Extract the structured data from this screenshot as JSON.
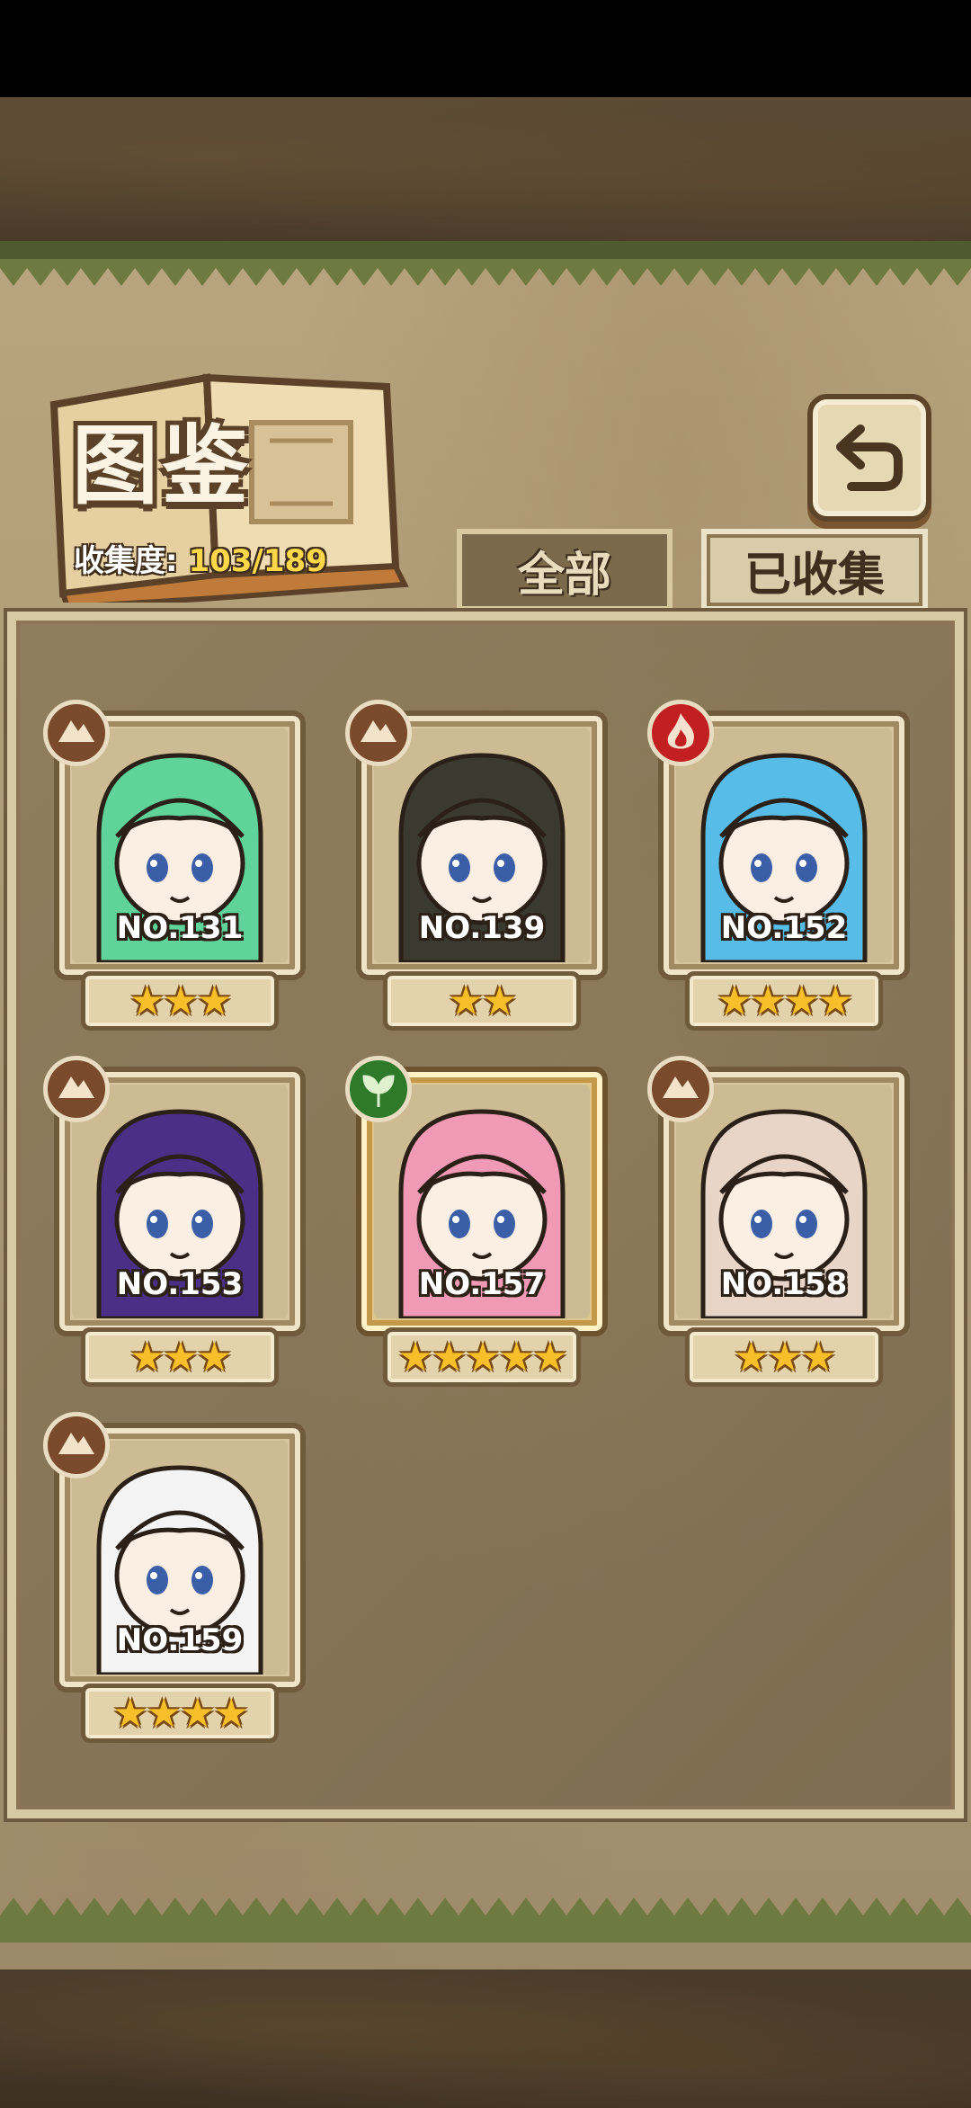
{
  "header": {
    "title": "图鉴",
    "collection_label": "收集度:",
    "collection_count": "103/189"
  },
  "tabs": [
    {
      "label": "全部",
      "selected": false
    },
    {
      "label": "已收集",
      "selected": true
    }
  ],
  "cards": [
    {
      "no": "NO.131",
      "stars": "★★★",
      "star_count": 3,
      "element": "earth-icon",
      "hair": "#5fd39a"
    },
    {
      "no": "NO.139",
      "stars": "★★",
      "star_count": 2,
      "element": "earth-icon",
      "hair": "#3b3a30"
    },
    {
      "no": "NO.152",
      "stars": "★★★★",
      "star_count": 4,
      "element": "fire-icon",
      "hair": "#57bde8"
    },
    {
      "no": "NO.153",
      "stars": "★★★",
      "star_count": 3,
      "element": "earth-icon",
      "hair": "#4a2f86"
    },
    {
      "no": "NO.157",
      "stars": "★★★★★",
      "star_count": 5,
      "element": "leaf-icon",
      "hair": "#f09ab5"
    },
    {
      "no": "NO.158",
      "stars": "★★★",
      "star_count": 3,
      "element": "earth-icon",
      "hair": "#e9d4c8"
    },
    {
      "no": "NO.159",
      "stars": "★★★★",
      "star_count": 4,
      "element": "earth-icon",
      "hair": "#f4f4f4"
    }
  ],
  "colors": {
    "earth": "#7a4a2c",
    "fire": "#c21f22",
    "leaf": "#2f7a2a",
    "count_yellow": "#ffd84a"
  }
}
